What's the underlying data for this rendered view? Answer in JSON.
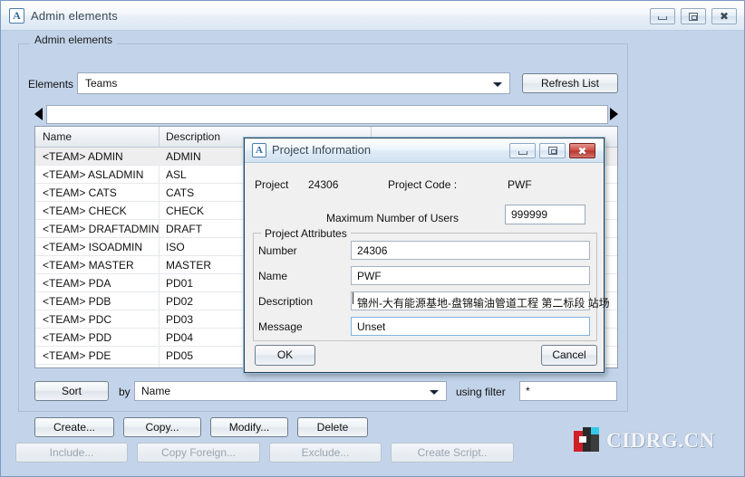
{
  "window": {
    "title": "Admin elements",
    "icon": "app-a-icon",
    "controls": {
      "minimize": "minimize-icon",
      "maximize": "maximize-icon",
      "close": "close-icon"
    }
  },
  "group": {
    "label": "Admin elements"
  },
  "elements_row": {
    "label": "Elements",
    "selected": "Teams",
    "refresh_label": "Refresh List"
  },
  "pager": {
    "left_icon": "arrow-left-icon",
    "right_icon": "arrow-right-icon",
    "value": ""
  },
  "table": {
    "columns": [
      "Name",
      "Description"
    ],
    "rows": [
      {
        "name": "<TEAM>  ADMIN",
        "description": "ADMIN",
        "selected": true
      },
      {
        "name": "<TEAM>  ASLADMIN",
        "description": "ASL",
        "selected": false
      },
      {
        "name": "<TEAM>  CATS",
        "description": "CATS",
        "selected": false
      },
      {
        "name": "<TEAM>  CHECK",
        "description": "CHECK",
        "selected": false
      },
      {
        "name": "<TEAM>  DRAFTADMIN",
        "description": "DRAFT",
        "selected": false
      },
      {
        "name": "<TEAM>  ISOADMIN",
        "description": "ISO",
        "selected": false
      },
      {
        "name": "<TEAM>  MASTER",
        "description": "MASTER",
        "selected": false
      },
      {
        "name": "<TEAM>  PDA",
        "description": "PD01",
        "selected": false
      },
      {
        "name": "<TEAM>  PDB",
        "description": "PD02",
        "selected": false
      },
      {
        "name": "<TEAM>  PDC",
        "description": "PD03",
        "selected": false
      },
      {
        "name": "<TEAM>  PDD",
        "description": "PD04",
        "selected": false
      },
      {
        "name": "<TEAM>  PDE",
        "description": "PD05",
        "selected": false
      },
      {
        "name": "",
        "description": "",
        "selected": false
      }
    ]
  },
  "sort_bar": {
    "sort_label": "Sort",
    "by_label": "by",
    "sort_field": "Name",
    "filter_label": "using filter",
    "filter_value": "*"
  },
  "actions": {
    "create": "Create...",
    "copy": "Copy...",
    "modify": "Modify...",
    "delete": "Delete",
    "include": "Include...",
    "copy_foreign": "Copy Foreign...",
    "exclude": "Exclude...",
    "create_script": "Create Script.."
  },
  "logo": {
    "text": "CIDRG.CN",
    "colors": {
      "red": "#cf2027",
      "dark": "#2b2b2b",
      "cyan": "#36c8e8"
    }
  },
  "dialog": {
    "title": "Project Information",
    "icon": "app-a-icon",
    "controls": {
      "minimize": "minimize-icon",
      "maximize": "maximize-icon",
      "close": "close-icon"
    },
    "close_color": "#cf5148",
    "project_label": "Project",
    "project_value": "24306",
    "project_code_label": "Project Code  :",
    "project_code_value": "PWF",
    "max_users_label": "Maximum Number of Users",
    "max_users_value": "999999",
    "attributes_group_label": "Project Attributes",
    "attributes": [
      {
        "label": "Number",
        "value": "24306"
      },
      {
        "label": "Name",
        "value": "PWF"
      },
      {
        "label": "Description",
        "value": "锦州-大有能源基地-盘锦输油管道工程 第二标段 站场"
      },
      {
        "label": "Message",
        "value": "Unset"
      }
    ],
    "ok_label": "OK",
    "cancel_label": "Cancel"
  }
}
